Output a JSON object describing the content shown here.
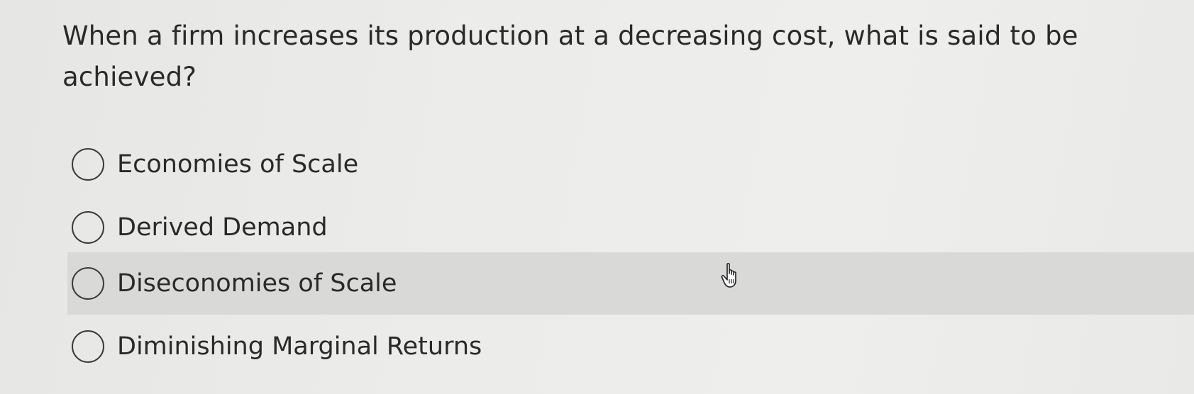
{
  "question": {
    "text": "When a firm increases its production at a decreasing cost, what is said to be achieved?"
  },
  "options": [
    {
      "label": "Economies of Scale",
      "selected": false,
      "hovered": false
    },
    {
      "label": "Derived Demand",
      "selected": false,
      "hovered": false
    },
    {
      "label": "Diseconomies of Scale",
      "selected": false,
      "hovered": true
    },
    {
      "label": "Diminishing Marginal Returns",
      "selected": false,
      "hovered": false
    }
  ],
  "cursor": {
    "icon": "hand-pointer-icon"
  },
  "colors": {
    "background": "#eaeae8",
    "hover_row": "#d9d9d7",
    "text": "#2a2a2a"
  }
}
